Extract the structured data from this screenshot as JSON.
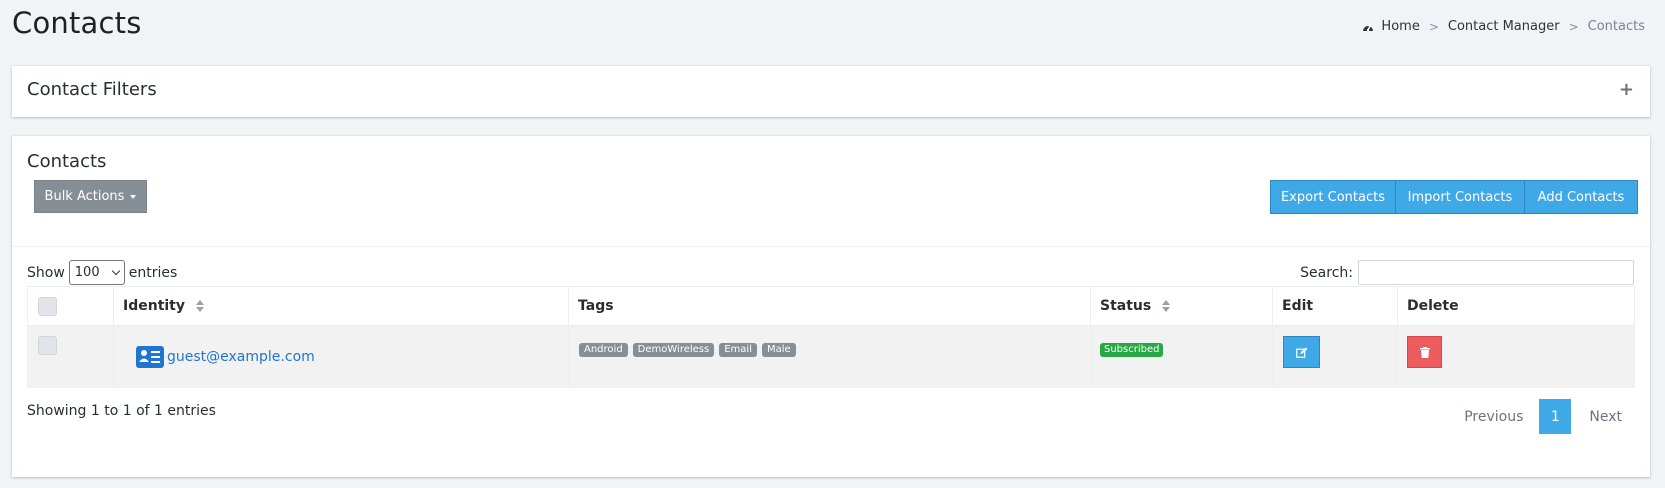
{
  "page": {
    "title": "Contacts"
  },
  "breadcrumb": {
    "items": [
      {
        "label": "Home",
        "icon": "dashboard-icon"
      },
      {
        "label": "Contact Manager"
      },
      {
        "label": "Contacts"
      }
    ],
    "separator": ">"
  },
  "filters_card": {
    "title": "Contact Filters",
    "toggle_icon": "+"
  },
  "contacts_card": {
    "title": "Contacts",
    "bulk_actions_label": "Bulk Actions",
    "export_label": "Export Contacts",
    "import_label": "Import Contacts",
    "add_label": "Add Contacts"
  },
  "table_controls": {
    "show_label": "Show",
    "entries_label": "entries",
    "page_length": "100",
    "search_label": "Search:",
    "search_value": ""
  },
  "table": {
    "columns": [
      "Identity",
      "Tags",
      "Status",
      "Edit",
      "Delete"
    ],
    "rows": [
      {
        "identity": "guest@example.com",
        "tags": [
          "Android",
          "DemoWireless",
          "Email",
          "Male"
        ],
        "status": "Subscribed"
      }
    ]
  },
  "footer": {
    "showing_text": "Showing 1 to 1 of 1 entries",
    "prev_label": "Previous",
    "current_page": "1",
    "next_label": "Next"
  },
  "colors": {
    "primary": "#3fa9e8",
    "secondary": "#868e96",
    "success": "#28a745",
    "danger": "#ec5b5d",
    "link": "#1f74d4",
    "background": "#f1f4f7"
  }
}
